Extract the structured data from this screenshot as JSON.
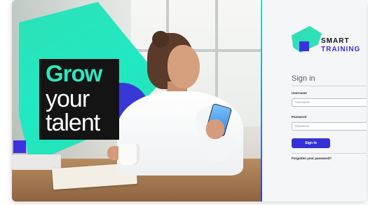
{
  "hero": {
    "headline": {
      "line1": "Grow",
      "line2": "your",
      "line3": "talent"
    }
  },
  "brand": {
    "line1": "SMART",
    "line2": "TRAINING",
    "colors": {
      "teal": "#2fe0b6",
      "indigo": "#3c2fe2",
      "dark": "#141414"
    }
  },
  "login": {
    "title": "Sign in",
    "username_label": "Username",
    "username_placeholder": "Username",
    "password_label": "Password",
    "password_placeholder": "Password",
    "submit_label": "Sign In",
    "forgot_label": "Forgotten your password?"
  }
}
